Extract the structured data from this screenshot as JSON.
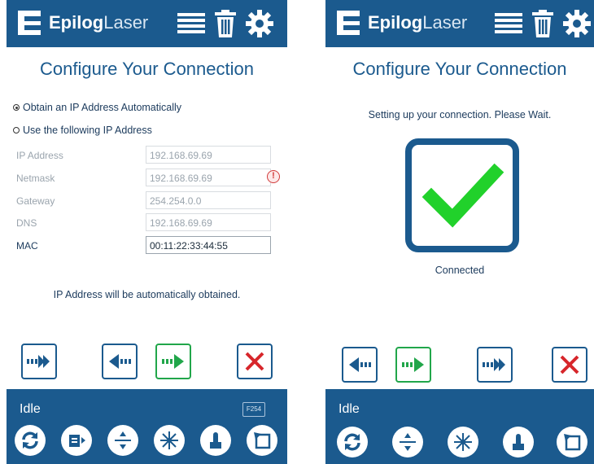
{
  "brand": {
    "bold": "Epilog",
    "light": "Laser"
  },
  "left_screen": {
    "title": "Configure Your Connection",
    "radio_auto": "Obtain an IP Address Automatically",
    "radio_manual": "Use the following IP Address",
    "selected_radio": "auto",
    "fields": [
      {
        "label": "IP Address",
        "value": "192.168.69.69"
      },
      {
        "label": "Netmask",
        "value": "192.168.69.69"
      },
      {
        "label": "Gateway",
        "value": "254.254.0.0"
      },
      {
        "label": "DNS",
        "value": "192.168.69.69"
      },
      {
        "label": "MAC",
        "value": "00:11:22:33:44:55"
      }
    ],
    "warning_symbol": "!",
    "info_message": "IP Address will be automatically obtained.",
    "status": "Idle",
    "firmware_badge": "F254"
  },
  "right_screen": {
    "title": "Configure Your Connection",
    "wait_message": "Setting up your connection. Please Wait.",
    "connected_label": "Connected",
    "status": "Idle"
  },
  "colors": {
    "brand_blue": "#1b5a8e",
    "success_green": "#21d12b",
    "next_green": "#21a64a",
    "cancel_red": "#d7262b"
  },
  "icons": {
    "header": [
      "menu-icon",
      "trash-icon",
      "gear-icon"
    ],
    "toolbar_left": [
      "refresh-icon",
      "job-icon",
      "focus-icon",
      "laser-pointer-icon",
      "jog-icon",
      "home-icon"
    ],
    "toolbar_right": [
      "refresh-icon",
      "focus-icon",
      "laser-pointer-icon",
      "jog-icon",
      "home-icon"
    ]
  }
}
